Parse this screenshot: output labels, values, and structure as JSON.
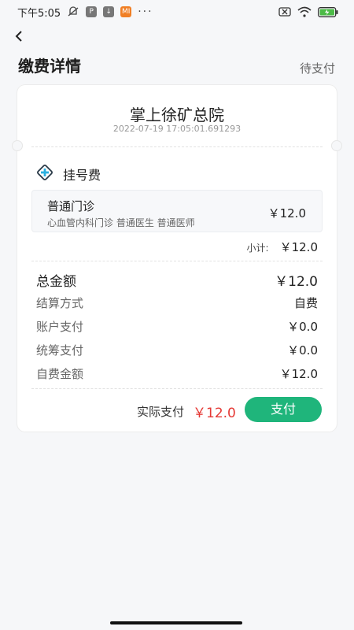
{
  "status_bar": {
    "time": "下午5:05",
    "mi_label": "MI",
    "more": "···"
  },
  "header": {
    "title": "缴费详情",
    "status": "待支付"
  },
  "card": {
    "hospital_name": "掌上徐矿总院",
    "timestamp": "2022-07-19 17:05:01.691293",
    "section_title": "挂号费",
    "item": {
      "name": "普通门诊",
      "desc": "心血管内科门诊 普通医生 普通医师",
      "price": "￥12.0"
    },
    "subtotal_label": "小计:",
    "subtotal_value": "￥12.0",
    "rows": [
      {
        "label": "总金额",
        "value": "￥12.0"
      },
      {
        "label": "结算方式",
        "value": "自费"
      },
      {
        "label": "账户支付",
        "value": "￥0.0"
      },
      {
        "label": "统筹支付",
        "value": "￥0.0"
      },
      {
        "label": "自费金额",
        "value": "￥12.0"
      }
    ],
    "actual_label": "实际支付",
    "actual_value": "￥12.0",
    "pay_button": "支付"
  },
  "colors": {
    "accent": "#1fb57b",
    "price_red": "#e53935",
    "background": "#f6f7f9"
  }
}
